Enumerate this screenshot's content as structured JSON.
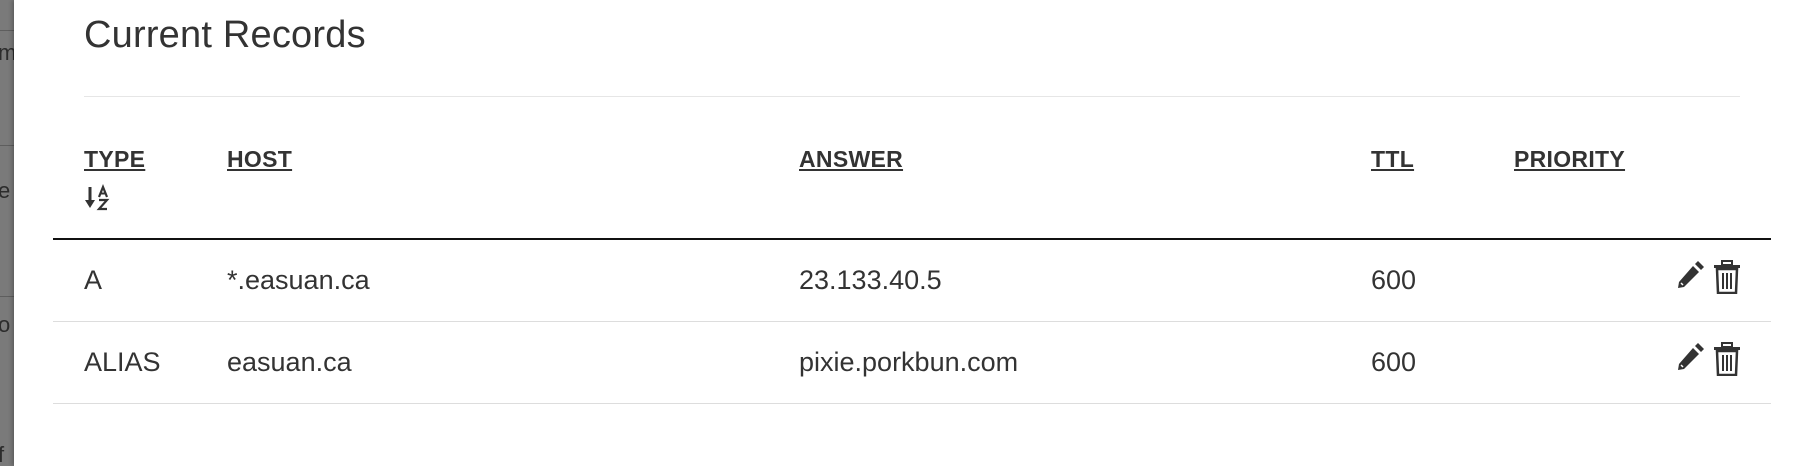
{
  "backdrop": {
    "letters": [
      "m",
      "e",
      "o",
      "f"
    ]
  },
  "section": {
    "title": "Current Records"
  },
  "table": {
    "headers": {
      "type": "TYPE",
      "host": "HOST",
      "answer": "ANSWER",
      "ttl": "TTL",
      "priority": "PRIORITY"
    },
    "sort": {
      "column": "type",
      "direction": "ascending",
      "icon": "sort-alpha-down-icon"
    },
    "rows": [
      {
        "type": "A",
        "host": "*.easuan.ca",
        "answer": "23.133.40.5",
        "ttl": "600",
        "priority": ""
      },
      {
        "type": "ALIAS",
        "host": "easuan.ca",
        "answer": "pixie.porkbun.com",
        "ttl": "600",
        "priority": ""
      }
    ],
    "row_actions": [
      "edit-icon",
      "trash-icon"
    ]
  },
  "colors": {
    "text": "#333333",
    "header_rule": "#111111",
    "row_rule": "#dddddd",
    "backdrop": "#7a7a7a"
  }
}
